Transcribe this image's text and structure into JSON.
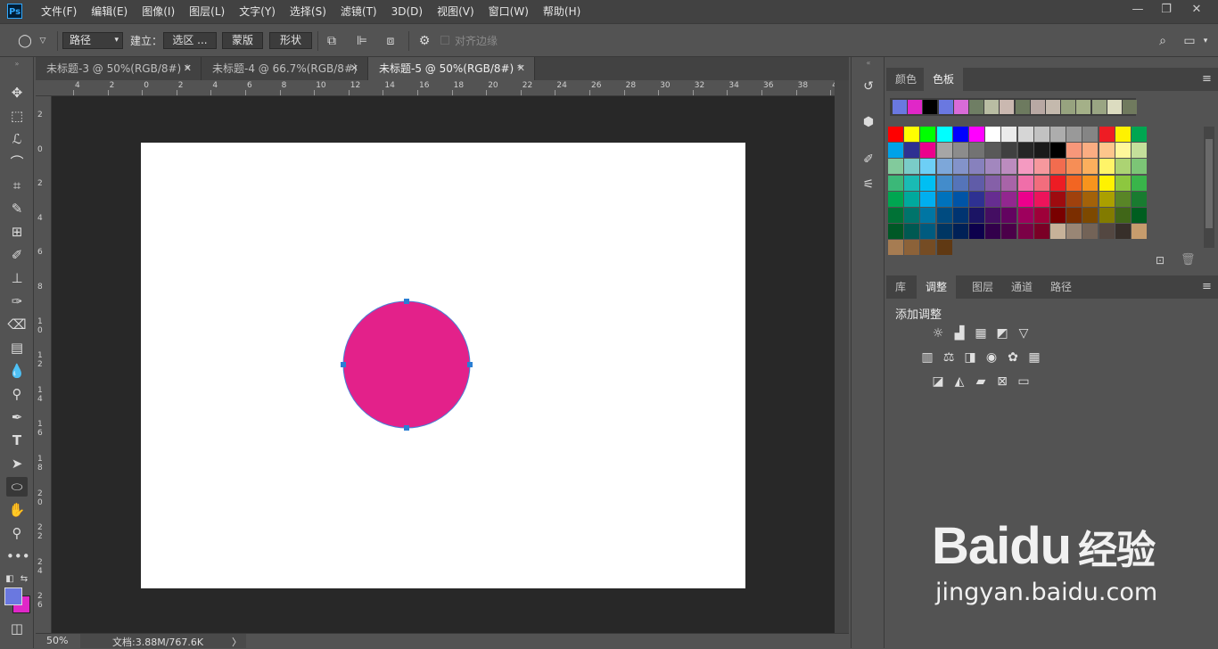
{
  "app": {
    "logo": "Ps"
  },
  "menu": [
    "文件(F)",
    "编辑(E)",
    "图像(I)",
    "图层(L)",
    "文字(Y)",
    "选择(S)",
    "滤镜(T)",
    "3D(D)",
    "视图(V)",
    "窗口(W)",
    "帮助(H)"
  ],
  "window_controls": {
    "minimize": "—",
    "restore": "❐",
    "close": "✕"
  },
  "options": {
    "tool_mode": "路径",
    "build_label": "建立：",
    "selection_btn": "选区 ...",
    "mask_btn": "蒙版",
    "shape_btn": "形状",
    "align_edges": "对齐边缘"
  },
  "tabs": [
    {
      "label": "未标题-3 @ 50%(RGB/8#) *",
      "active": false
    },
    {
      "label": "未标题-4 @ 66.7%(RGB/8#)",
      "active": false
    },
    {
      "label": "未标题-5 @ 50%(RGB/8#) *",
      "active": true
    }
  ],
  "tab_close": "✕",
  "ruler_top_labels": [
    "4",
    "2",
    "0",
    "2",
    "4",
    "6",
    "8",
    "10",
    "12",
    "14",
    "16",
    "18",
    "20",
    "22",
    "24",
    "26",
    "28",
    "30",
    "32",
    "34",
    "36",
    "38",
    "40"
  ],
  "ruler_left_labels": [
    "2",
    "0",
    "2",
    "4",
    "6",
    "8",
    "1 0",
    "1 2",
    "1 4",
    "1 6",
    "1 8",
    "2 0",
    "2 2",
    "2 4",
    "2 6"
  ],
  "shape": {
    "fill": "#e3218a",
    "stroke": "#4a7fd6",
    "anchor_color": "#2a7fd4"
  },
  "status": {
    "zoom": "50%",
    "doc_info": "文档:3.88M/767.6K",
    "arrow": "〉"
  },
  "colors": {
    "foreground": "#6a78e0",
    "background": "#e027c8"
  },
  "swatch_panel": {
    "tabs": [
      "颜色",
      "色板"
    ],
    "active_tab": "色板",
    "recent": [
      "#6a78e0",
      "#e027c8",
      "#000000",
      "#6a78e0",
      "#d96bd8",
      "#6f7e64",
      "#b9bda3",
      "#cab8b0",
      "#6d7a5f",
      "#b8a8a3",
      "#c4b9ad",
      "#97a37f",
      "#a4b088",
      "#9aa583",
      "#dcdcc0",
      "#707a5e"
    ],
    "rows": [
      [
        "#ff0000",
        "#ffff00",
        "#00ff00",
        "#00ffff",
        "#0000ff",
        "#ff00ff",
        "#ffffff",
        "#ebebeb",
        "#d6d6d6",
        "#c2c2c2",
        "#adadad",
        "#999999",
        "#858585",
        "#ee1c24",
        "#fff200",
        "#00a651"
      ],
      [
        "#00a2e8",
        "#2e3192",
        "#ec008c",
        "#a6a6a6",
        "#8c8c8c",
        "#737373",
        "#595959",
        "#404040",
        "#262626",
        "#1a1a1a",
        "#000000",
        "#f7977a",
        "#fbad82",
        "#fdc68c",
        "#fff79a",
        "#c4df9b"
      ],
      [
        "#82ca9c",
        "#7accc8",
        "#6dcff6",
        "#7da7d9",
        "#8393ca",
        "#8781bd",
        "#a287be",
        "#bc8cbf",
        "#f49ac1",
        "#f6989d",
        "#f26c4f",
        "#f68e56",
        "#fbaf5d",
        "#fff468",
        "#acd373",
        "#7cc576"
      ],
      [
        "#3bb878",
        "#1abbb4",
        "#00bff3",
        "#438ccb",
        "#5574b9",
        "#605ca8",
        "#8560a8",
        "#a864a8",
        "#f06ea9",
        "#f26d7d",
        "#ed1c24",
        "#f26522",
        "#f7941d",
        "#fff200",
        "#8dc73f",
        "#39b54a"
      ],
      [
        "#00a651",
        "#00a99d",
        "#00aeef",
        "#0072bc",
        "#0054a6",
        "#2e3192",
        "#662d91",
        "#92278f",
        "#ec008c",
        "#ed145b",
        "#9e0b0f",
        "#a0410d",
        "#a36209",
        "#aba000",
        "#598527",
        "#197b30"
      ],
      [
        "#007236",
        "#00746b",
        "#0076a3",
        "#004b80",
        "#003471",
        "#1b1464",
        "#440e62",
        "#630460",
        "#9e005d",
        "#9e0039",
        "#790000",
        "#7b2e00",
        "#7d4900",
        "#827b00",
        "#406618",
        "#005e20"
      ],
      [
        "#005826",
        "#005952",
        "#005b7f",
        "#003663",
        "#002157",
        "#0d004c",
        "#32004b",
        "#4b0049",
        "#7b0046",
        "#7a0026",
        "#c7b299",
        "#998675",
        "#736357",
        "#534741",
        "#372f2a",
        "#c69c6d"
      ],
      [
        "#a67c52",
        "#8c6239",
        "#754c24",
        "#603913"
      ]
    ]
  },
  "adjust_panel": {
    "tabs": [
      "库",
      "调整",
      "图层",
      "通道",
      "路径"
    ],
    "active_tab": "调整",
    "title": "添加调整"
  },
  "watermark": {
    "brand": "Baidu",
    "cn": "经验",
    "url": "jingyan.baidu.com"
  }
}
